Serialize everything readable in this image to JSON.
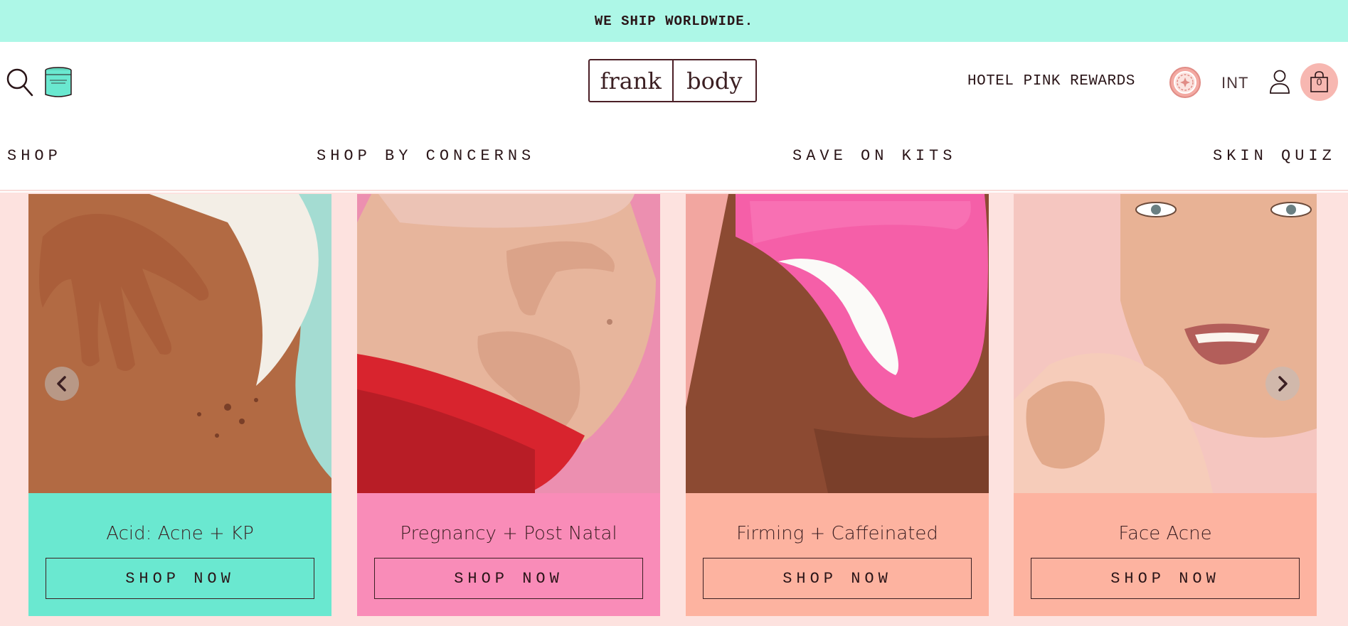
{
  "announcement": "WE SHIP WORLDWIDE.",
  "header": {
    "logo_left": "frank",
    "logo_right": "body",
    "rewards_label": "HOTEL PINK REWARDS",
    "region": "INT",
    "cart_count": "0"
  },
  "nav": {
    "items": [
      {
        "label": "SHOP"
      },
      {
        "label": "SHOP BY CONCERNS"
      },
      {
        "label": "SAVE ON KITS"
      },
      {
        "label": "SKIN QUIZ"
      }
    ]
  },
  "cards": [
    {
      "title": "Acid: Acne + KP",
      "button": "SHOP NOW",
      "color": "#6ae8d0",
      "photo_bg": "#a4dcd2"
    },
    {
      "title": "Pregnancy + Post Natal",
      "button": "SHOP NOW",
      "color": "#f98cb8",
      "photo_bg": "#ec8fb0"
    },
    {
      "title": "Firming + Caffeinated",
      "button": "SHOP NOW",
      "color": "#fdb3a0",
      "photo_bg": "#f2a6a0"
    },
    {
      "title": "Face Acne",
      "button": "SHOP NOW",
      "color": "#fdb3a0",
      "photo_bg": "#f5c6c0"
    }
  ],
  "colors": {
    "announcement_bg": "#adf7e7",
    "carousel_bg": "#fde2df",
    "text": "#3b1f22",
    "cart_bg": "#f7b7b1"
  },
  "icons": [
    "search-icon",
    "jar-icon",
    "rewards-badge-icon",
    "account-icon",
    "bag-icon",
    "chevron-left-icon",
    "chevron-right-icon"
  ]
}
